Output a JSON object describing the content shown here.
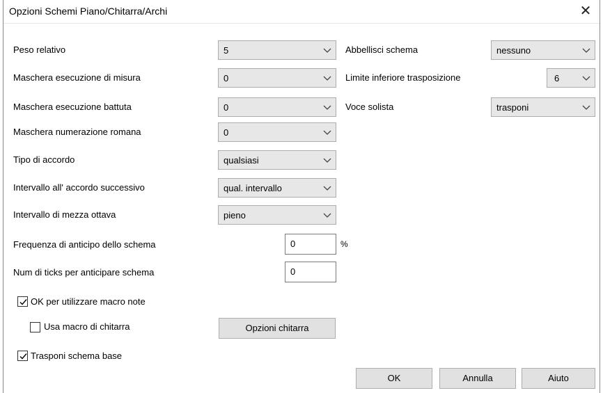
{
  "window": {
    "title": "Opzioni Schemi Piano/Chitarra/Archi"
  },
  "left": {
    "peso_relativo": {
      "label": "Peso relativo",
      "value": "5"
    },
    "maschera_misura": {
      "label": "Maschera esecuzione di misura",
      "value": "0"
    },
    "maschera_battuta": {
      "label": "Maschera esecuzione battuta",
      "value": "0"
    },
    "maschera_romana": {
      "label": "Maschera numerazione romana",
      "value": "0"
    },
    "tipo_accordo": {
      "label": "Tipo di accordo",
      "value": "qualsiasi"
    },
    "intervallo_successivo": {
      "label": "Intervallo all' accordo successivo",
      "value": "qual. intervallo"
    },
    "mezza_ottava": {
      "label": "Intervallo di mezza ottava",
      "value": "pieno"
    },
    "frequenza_anticipo": {
      "label": "Frequenza di anticipo dello schema",
      "value": "0",
      "unit": "%"
    },
    "ticks_anticipo": {
      "label": "Num di ticks per anticipare schema",
      "value": "0"
    }
  },
  "right": {
    "abbellisci": {
      "label": "Abbellisci schema",
      "value": "nessuno"
    },
    "limite_trasposizione": {
      "label": "Limite inferiore trasposizione",
      "value": "6"
    },
    "voce_solista": {
      "label": "Voce solista",
      "value": "trasponi"
    }
  },
  "checks": {
    "macro_note": {
      "label": "OK per utilizzare macro note",
      "checked": true
    },
    "macro_chitarra": {
      "label": "Usa macro di chitarra",
      "checked": false
    },
    "trasponi_base": {
      "label": "Trasponi schema base",
      "checked": true
    }
  },
  "buttons": {
    "opzioni_chitarra": "Opzioni chitarra",
    "ok": "OK",
    "annulla": "Annulla",
    "aiuto": "Aiuto"
  },
  "icons": {
    "close": "close-icon",
    "dropdown": "chevron-down-icon",
    "check": "checkmark-icon"
  }
}
